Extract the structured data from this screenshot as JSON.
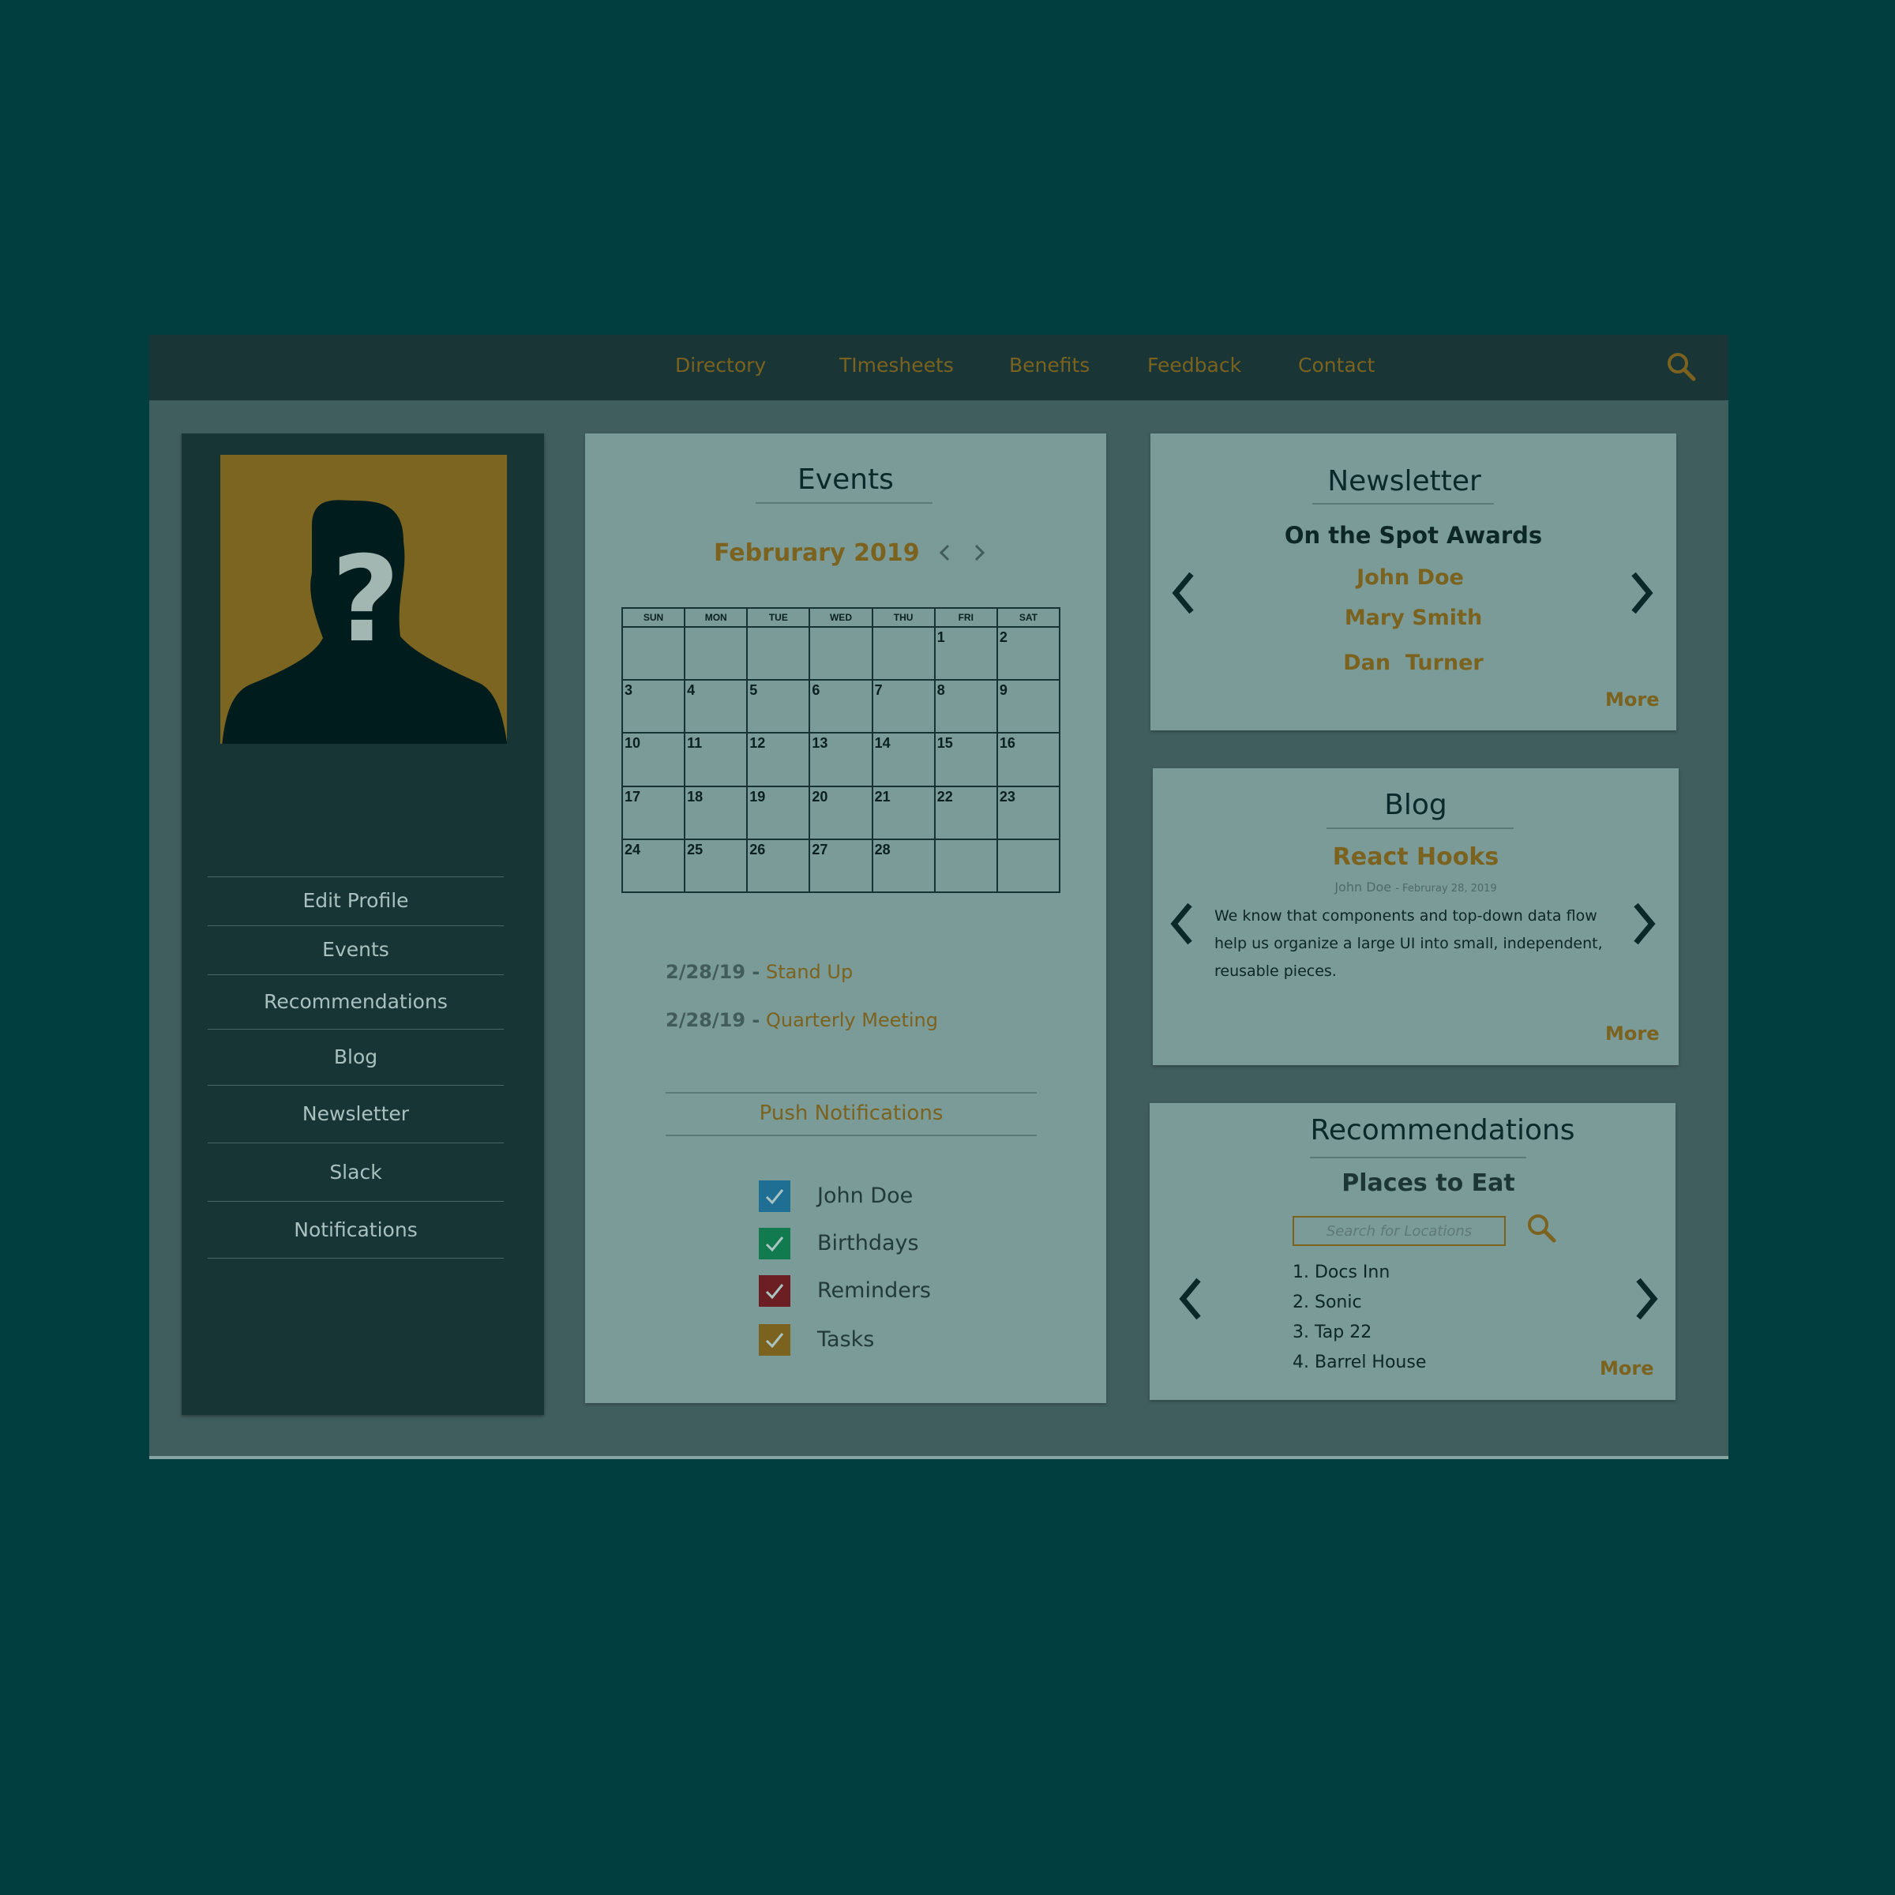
{
  "nav": {
    "items": [
      {
        "label": "Directory"
      },
      {
        "label": "TImesheets"
      },
      {
        "label": "Benefits"
      },
      {
        "label": "Feedback"
      },
      {
        "label": "Contact"
      }
    ],
    "search_icon": "search-icon"
  },
  "sidebar": {
    "avatar_icon": "unknown-person-icon",
    "items": [
      {
        "label": "Edit Profile"
      },
      {
        "label": "Events"
      },
      {
        "label": "Recommendations"
      },
      {
        "label": "Blog"
      },
      {
        "label": "Newsletter"
      },
      {
        "label": "Slack"
      },
      {
        "label": "Notifications"
      }
    ]
  },
  "events": {
    "title": "Events",
    "month": "Februrary 2019",
    "weekdays": [
      "SUN",
      "MON",
      "TUE",
      "WED",
      "THU",
      "FRI",
      "SAT"
    ],
    "weeks": [
      [
        "",
        "",
        "",
        "",
        "",
        "1",
        "2"
      ],
      [
        "3",
        "4",
        "5",
        "6",
        "7",
        "8",
        "9"
      ],
      [
        "10",
        "11",
        "12",
        "13",
        "14",
        "15",
        "16"
      ],
      [
        "17",
        "18",
        "19",
        "20",
        "21",
        "22",
        "23"
      ],
      [
        "24",
        "25",
        "26",
        "27",
        "28",
        "",
        ""
      ]
    ],
    "list": [
      {
        "date": "2/28/19 -",
        "title": "Stand Up"
      },
      {
        "date": "2/28/19 -",
        "title": "Quarterly Meeting"
      }
    ],
    "push_title": "Push Notifications",
    "notifications": [
      {
        "label": "John Doe",
        "color": "#1f6f94",
        "checked": true
      },
      {
        "label": "Birthdays",
        "color": "#117a4f",
        "checked": true
      },
      {
        "label": "Reminders",
        "color": "#6b1f22",
        "checked": true
      },
      {
        "label": "Tasks",
        "color": "#7b621f",
        "checked": true
      }
    ]
  },
  "newsletter": {
    "title": "Newsletter",
    "headline": "On the Spot Awards",
    "names": [
      "John Doe",
      "Mary Smith",
      "Dan  Turner"
    ],
    "more": "More"
  },
  "blog": {
    "title": "Blog",
    "post_title": "React Hooks",
    "author": "John Doe",
    "date": "- Februray 28, 2019",
    "body": "We know that components and top-down data flow help us organize a large UI into small, independent, reusable pieces.",
    "more": "More"
  },
  "recommendations": {
    "title": "Recommendations",
    "subtitle": "Places to Eat",
    "search_placeholder": "Search for Locations",
    "items": [
      "1. Docs Inn",
      "2. Sonic",
      "3. Tap 22",
      "4. Barrel House"
    ],
    "more": "More"
  },
  "colors": {
    "background": "#013e3f",
    "accent": "#7b621f",
    "card": "#7a9b97",
    "sidebar": "#183536"
  }
}
